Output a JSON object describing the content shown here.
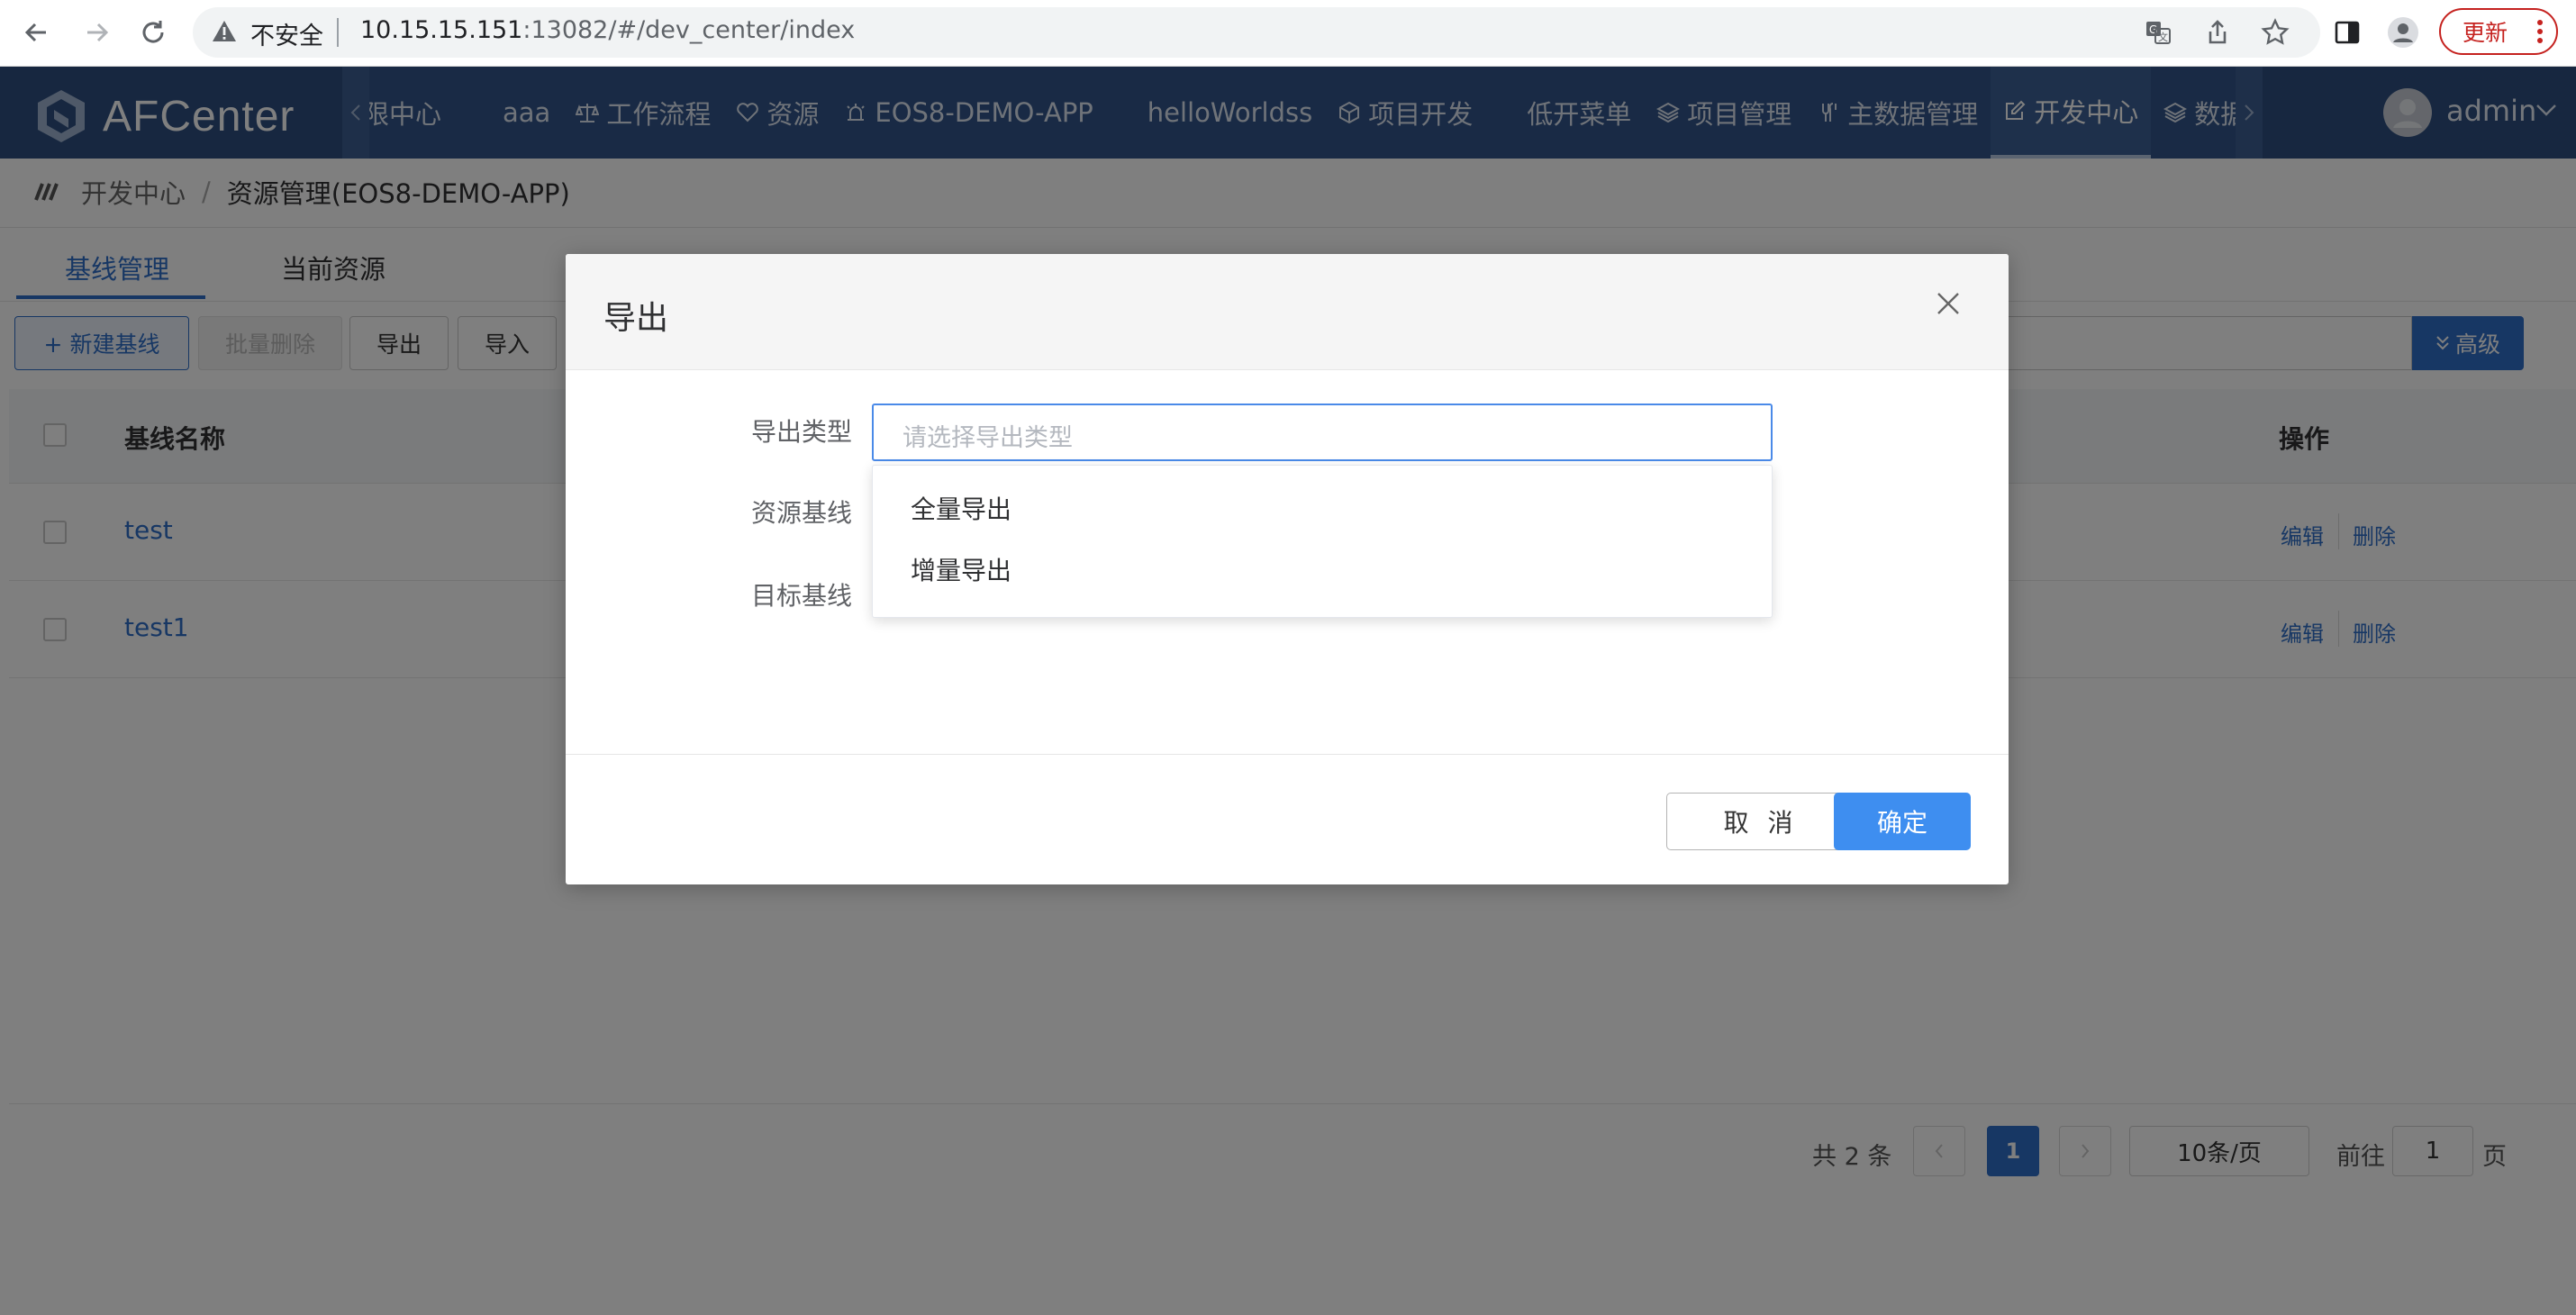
{
  "browser": {
    "security_label": "不安全",
    "url_host": "10.15.15.151",
    "url_rest": ":13082/#/dev_center/index",
    "update_label": "更新"
  },
  "app": {
    "logo_text": "AFCenter",
    "nav_items": [
      {
        "label": "权限中心",
        "icon": ""
      },
      {
        "label": "aaa",
        "icon": ""
      },
      {
        "label": "工作流程",
        "icon": "scale-icon"
      },
      {
        "label": "资源",
        "icon": "heart-icon"
      },
      {
        "label": "EOS8-DEMO-APP",
        "icon": "alarm-icon"
      },
      {
        "label": "helloWorldss",
        "icon": ""
      },
      {
        "label": "项目开发",
        "icon": "cube-icon"
      },
      {
        "label": "低开菜单",
        "icon": ""
      },
      {
        "label": "项目管理",
        "icon": "layers-icon"
      },
      {
        "label": "主数据管理",
        "icon": "tools-icon"
      },
      {
        "label": "开发中心",
        "icon": "edit-icon",
        "active": true
      },
      {
        "label": "数据建模",
        "icon": "layers-icon"
      }
    ],
    "user_name": "admin"
  },
  "breadcrumb": {
    "level1": "开发中心",
    "separator": "/",
    "level2": "资源管理(EOS8-DEMO-APP)"
  },
  "tabs": {
    "baseline": "基线管理",
    "current": "当前资源"
  },
  "toolbar": {
    "new_label": "+ 新建基线",
    "batch_delete_label": "批量删除",
    "export_label": "导出",
    "import_label": "导入",
    "advanced_label": "高级"
  },
  "table": {
    "col_name": "基线名称",
    "col_ops": "操作",
    "rows": [
      {
        "name": "test",
        "edit": "编辑",
        "delete": "删除"
      },
      {
        "name": "test1",
        "edit": "编辑",
        "delete": "删除"
      }
    ]
  },
  "pagination": {
    "total": "共 2 条",
    "current": "1",
    "page_size": "10条/页",
    "goto_label": "前往",
    "goto_value": "1",
    "page_suffix": "页"
  },
  "dialog": {
    "title": "导出",
    "type_label": "导出类型",
    "type_placeholder": "请选择导出类型",
    "source_label": "资源基线",
    "target_label": "目标基线",
    "options": [
      "全量导出",
      "增量导出"
    ],
    "cancel_label": "取 消",
    "confirm_label": "确定"
  },
  "colors": {
    "header_bg": "#2e4f80",
    "primary": "#2f6fc9",
    "confirm": "#3e8ef0"
  }
}
